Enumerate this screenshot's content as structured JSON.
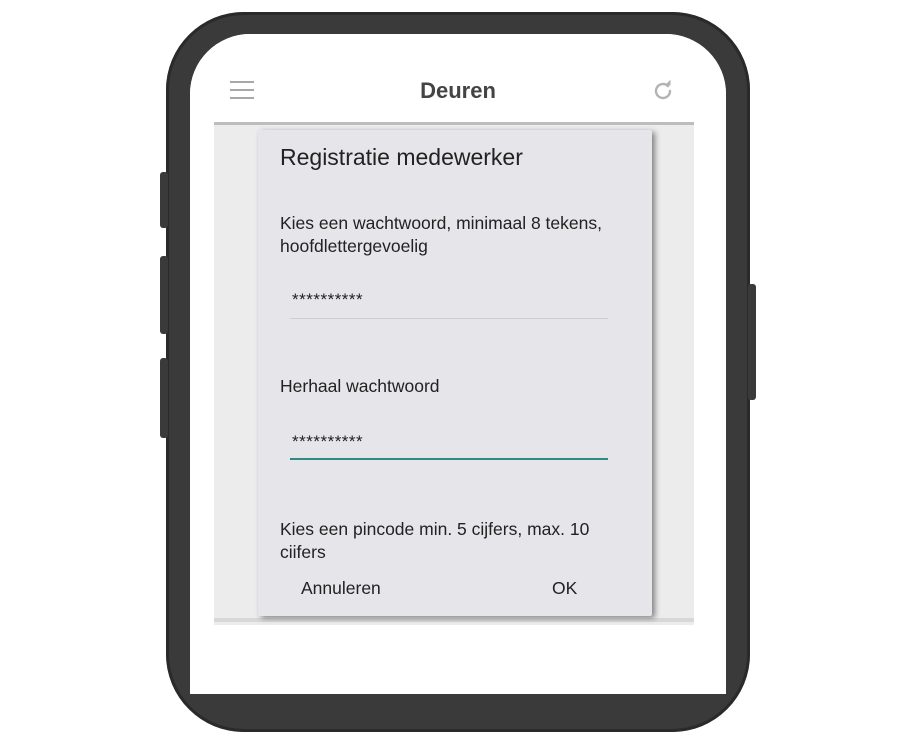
{
  "appbar": {
    "title": "Deuren",
    "menu_icon": "hamburger-menu-icon",
    "refresh_icon": "refresh-icon"
  },
  "dialog": {
    "title": "Registratie medewerker",
    "password_label": "Kies een wachtwoord, minimaal 8 tekens, hoofdlettergevoelig",
    "password_value": "**********",
    "repeat_label": "Herhaal wachtwoord",
    "repeat_value": "**********",
    "pincode_label": "Kies een pincode min. 5 cijfers, max. 10 ciifers",
    "cancel_label": "Annuleren",
    "ok_label": "OK"
  },
  "colors": {
    "focus_underline": "#2e8b7f",
    "dialog_bg": "#e6e5ea",
    "phone_frame": "#3a3a3a"
  }
}
